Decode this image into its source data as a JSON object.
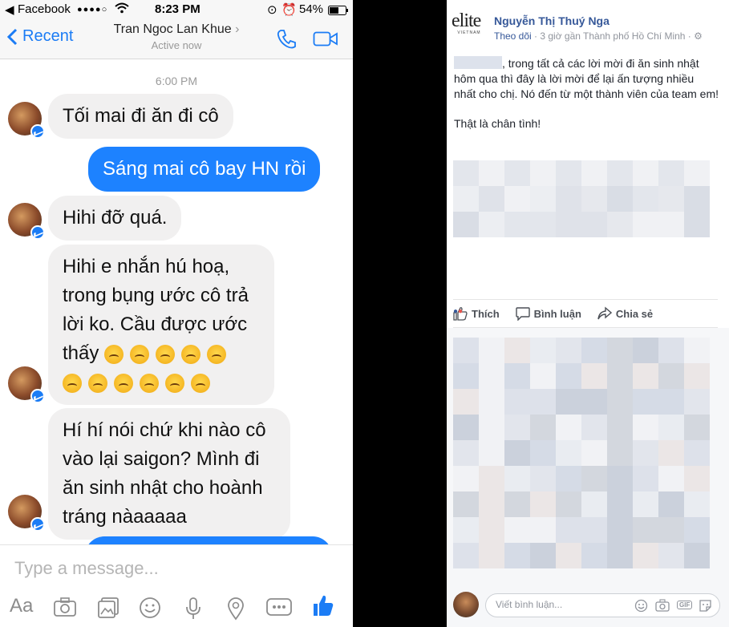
{
  "messenger": {
    "status_bar": {
      "carrier": "Facebook",
      "time": "8:23 PM",
      "battery": "54%"
    },
    "nav": {
      "back_label": "Recent",
      "contact_name": "Tran Ngoc Lan Khue",
      "contact_status": "Active now"
    },
    "timestamp": "6:00 PM",
    "messages": [
      {
        "text": "Tối mai đi ăn đi cô"
      },
      {
        "text": "Sáng mai cô bay HN rồi"
      },
      {
        "text": "Hihi đỡ quá."
      },
      {
        "lines": [
          "Hihi e nhắn hú hoạ,",
          "trong bụng ước cô trả",
          "lời ko. Cầu được ước",
          "thấy"
        ],
        "emoji_row1": 5,
        "emoji_row2": 6
      },
      {
        "lines": [
          "Hí hí nói chứ khi nào cô",
          "vào lại saigon? Mình đi",
          "ăn sinh nhật cho hoành",
          "tráng nàaaaaa"
        ]
      }
    ],
    "composer": {
      "placeholder": "Type a message...",
      "aa_label": "Aa"
    },
    "colors": {
      "accent": "#1d82ff",
      "bubble_in": "#f1f0f0"
    }
  },
  "post": {
    "logo_text": "elite",
    "logo_sub": "VIETNAM",
    "author": "Nguyễn Thị Thuý Nga",
    "follow_label": "Theo dõi",
    "meta": " · 3 giờ gần Thành phố Hồ Chí Minh · ",
    "paragraph1": ", trong tất cả các lời mời đi ăn sinh nhật hôm qua thì đây là lời mời để lại ấn tượng nhiều nhất cho chị. Nó đến từ một thành viên của team em!",
    "paragraph2": "Thật là chân tình!",
    "actions": {
      "like": "Thích",
      "comment": "Bình luận",
      "share": "Chia sẻ"
    },
    "comment_placeholder": "Viết bình luận...",
    "gif_label": "GIF",
    "colors": {
      "link": "#365899",
      "meta": "#90949c"
    }
  }
}
